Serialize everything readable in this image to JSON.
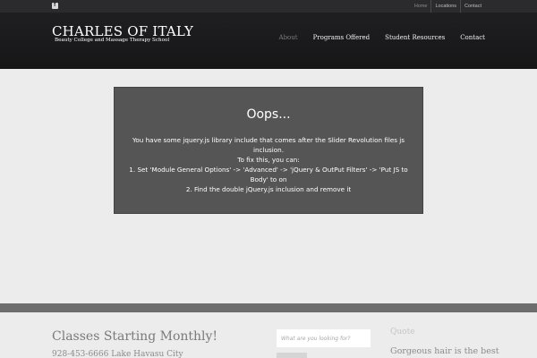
{
  "topbar": {
    "social_icon": "facebook-icon",
    "links": [
      "Home",
      "Locations",
      "Contact"
    ]
  },
  "header": {
    "title": "CHARLES OF ITALY",
    "subtitle": "Beauty College and Massage Therapy School",
    "nav": [
      "About",
      "Programs Offered",
      "Student Resources",
      "Contact"
    ]
  },
  "slider": {
    "title": "Oops...",
    "line1": "You have some jquery.js library include that comes after the Slider Revolution files js inclusion.",
    "line2": "To fix this, you can:",
    "line3": "1. Set 'Module General Options' -> 'Advanced' -> 'jQuery & OutPut Filters' -> 'Put JS to Body' to on",
    "line4": "2. Find the double jQuery.js inclusion and remove it"
  },
  "footer": {
    "classes_title": "Classes Starting Monthly!",
    "phone": "928-453-6666 Lake Havasu City",
    "search_placeholder": "What are you looking for?",
    "quote_label": "Quote",
    "quote_text": "Gorgeous hair is the best"
  },
  "colors": {
    "topbar": "#2b2b2d",
    "header": "#1a1a1b",
    "error_box": "#555555",
    "stripe": "#6d6d6d",
    "page_bg": "#ececec"
  }
}
